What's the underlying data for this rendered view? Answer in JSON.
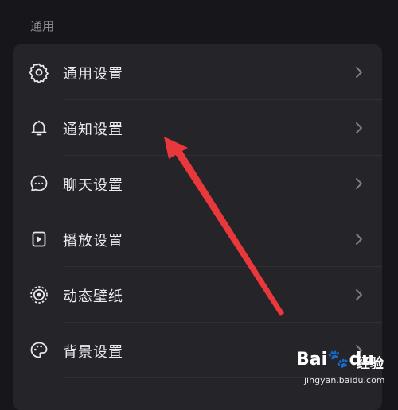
{
  "section": {
    "title": "通用"
  },
  "items": [
    {
      "label": "通用设置",
      "icon": "gear-icon"
    },
    {
      "label": "通知设置",
      "icon": "bell-icon"
    },
    {
      "label": "聊天设置",
      "icon": "chat-bubble-icon"
    },
    {
      "label": "播放设置",
      "icon": "playback-icon"
    },
    {
      "label": "动态壁纸",
      "icon": "live-wallpaper-icon"
    },
    {
      "label": "背景设置",
      "icon": "palette-icon"
    }
  ],
  "annotation": {
    "color": "#e8383b"
  },
  "watermark": {
    "logo_left": "Bai",
    "logo_paw": "🐾",
    "logo_right": "du",
    "cn": "经验",
    "url": "jingyan.baidu.com"
  },
  "colors": {
    "background": "#17171b",
    "card": "#242429",
    "text": "#ececf0",
    "muted": "#8b8b92"
  }
}
